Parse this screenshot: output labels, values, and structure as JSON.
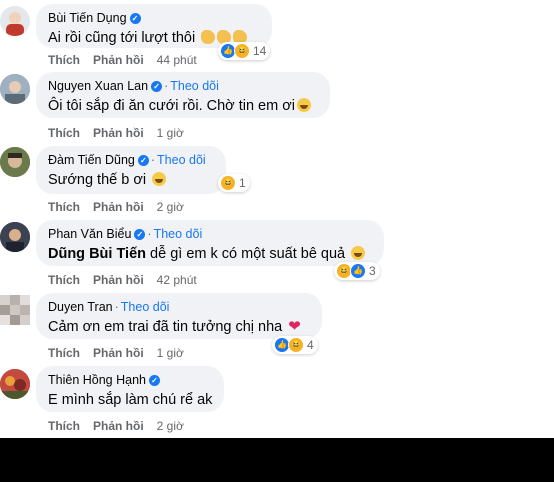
{
  "comments": [
    {
      "author": "Bùi Tiến Dụng",
      "verified": true,
      "follow": "",
      "text": "Ai rồi cũng tới lượt thôi",
      "actions": {
        "like": "Thích",
        "reply": "Phản hồi",
        "time": "44 phút"
      },
      "reaction_count": "14",
      "avatar_color": "#d9dde3"
    },
    {
      "author": "Nguyen Xuan Lan",
      "verified": true,
      "follow": "Theo dõi",
      "text": "Ôi tôi sắp đi ăn cưới rồi. Chờ tin em ơi",
      "actions": {
        "like": "Thích",
        "reply": "Phản hồi",
        "time": "1 giờ"
      },
      "reaction_count": "",
      "avatar_color": "#8fa3b5"
    },
    {
      "author": "Đàm Tiến Dũng",
      "verified": true,
      "follow": "Theo dõi",
      "text": "Sướng thế b ơi",
      "actions": {
        "like": "Thích",
        "reply": "Phản hồi",
        "time": "2 giờ"
      },
      "reaction_count": "1",
      "avatar_color": "#5c6b3f"
    },
    {
      "author": "Phan Văn Biểu",
      "verified": true,
      "follow": "Theo dõi",
      "mention": "Dũng Bùi Tiến",
      "text": "dễ gì em k có một suất bê quả",
      "actions": {
        "like": "Thích",
        "reply": "Phản hồi",
        "time": "42 phút"
      },
      "reaction_count": "3",
      "avatar_color": "#4a5060"
    },
    {
      "author": "Duyen Tran",
      "verified": false,
      "follow": "Theo dõi",
      "text": "Cảm ơn em trai đã tin tưởng chị nha",
      "actions": {
        "like": "Thích",
        "reply": "Phản hồi",
        "time": "1 giờ"
      },
      "reaction_count": "4",
      "avatar_color": "#c9c4c1"
    },
    {
      "author": "Thiên Hồng Hạnh",
      "verified": true,
      "follow": "",
      "text": "E mình sắp làm chú rể ak",
      "actions": {
        "like": "Thích",
        "reply": "Phản hồi",
        "time": "2 giờ"
      },
      "reaction_count": "",
      "avatar_color": "#b5413a"
    }
  ],
  "colors": {
    "link": "#1877f2",
    "bubble": "#f0f2f5",
    "meta": "#65676b"
  }
}
